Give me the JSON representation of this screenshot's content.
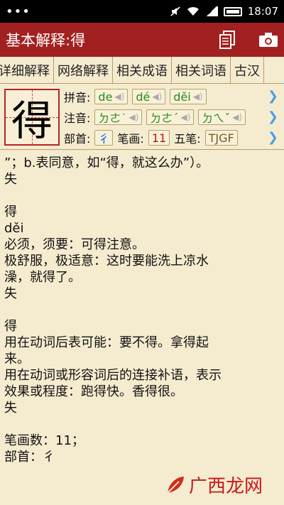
{
  "status": {
    "dots": "•••",
    "time": "18:07"
  },
  "title_bar": {
    "title": "基本解释:得"
  },
  "tabs": [
    {
      "label": "详细解释"
    },
    {
      "label": "网络解释"
    },
    {
      "label": "相关成语"
    },
    {
      "label": "相关词语"
    },
    {
      "label": "古汉"
    }
  ],
  "char": {
    "glyph": "得",
    "pinyin_label": "拼音:",
    "pinyin": [
      "de",
      "dé",
      "děi"
    ],
    "zhuyin_label": "注音:",
    "zhuyin": [
      "ㄉㄜ˙",
      "ㄉㄜˊ",
      "ㄉㄟˇ"
    ],
    "radical_label": "部首:",
    "radical": "彳",
    "strokes_label": "笔画:",
    "strokes": "11",
    "wubi_label": "五笔:",
    "wubi": "TJGF",
    "arrow": "❯"
  },
  "content_lines": [
    "”；b.表同意，如“得，就这么办”）。",
    "失",
    "",
    "得",
    "děi",
    "必须，须要：可得注意。",
    "极舒服，极适意：这时要能洗上凉水",
    "澡，就得了。",
    "失",
    "",
    "得",
    "用在动词后表可能：要不得。拿得起",
    "来。",
    "用在动词或形容词后的连接补语，表示",
    "效果或程度：跑得快。香得很。",
    "失",
    "",
    "笔画数：11；",
    "部首：彳"
  ],
  "watermark": {
    "text": "广西龙网"
  }
}
